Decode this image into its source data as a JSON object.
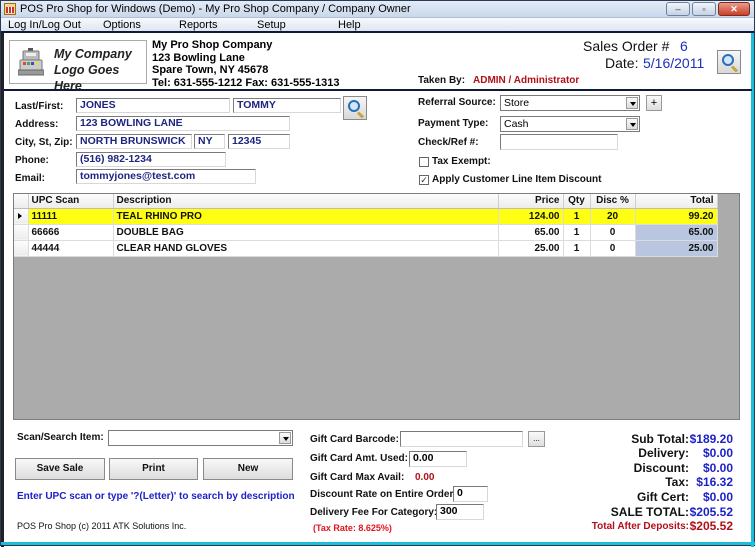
{
  "window": {
    "title": "POS Pro Shop for Windows (Demo)  - My Pro Shop Company / Company Owner",
    "minimize": "–",
    "maximize": "▫",
    "close": "✕"
  },
  "menu": [
    "Log In/Log Out",
    "Options",
    "Reports",
    "Setup",
    "Help"
  ],
  "logo": {
    "line1": "My Company",
    "line2": "Logo Goes Here"
  },
  "company": {
    "name": "My Pro Shop Company",
    "address": "123 Bowling Lane",
    "city": "Spare Town, NY 45678",
    "contact": "Tel: 631-555-1212  Fax: 631-555-1313"
  },
  "order": {
    "number_label": "Sales Order #",
    "number": "6",
    "date_label": "Date:",
    "date": "5/16/2011",
    "taken_by_label": "Taken By:",
    "taken_by": "ADMIN / Administrator"
  },
  "customer": {
    "last_first_label": "Last/First:",
    "last": "JONES",
    "first": "TOMMY",
    "address_label": "Address:",
    "address": "123 BOWLING LANE",
    "city_label": "City, St, Zip:",
    "city": "NORTH BRUNSWICK",
    "state": "NY",
    "zip": "12345",
    "phone_label": "Phone:",
    "phone": "(516) 982-1234",
    "email_label": "Email:",
    "email": "tommyjones@test.com"
  },
  "sale_options": {
    "referral_label": "Referral Source:",
    "referral": "Store",
    "add_label": "+",
    "payment_label": "Payment Type:",
    "payment": "Cash",
    "check_label": "Check/Ref #:",
    "check": "",
    "tax_exempt_label": "Tax Exempt:",
    "tax_exempt": false,
    "apply_discount_label": "Apply Customer Line Item Discount",
    "apply_discount": true
  },
  "grid": {
    "columns": [
      "UPC Scan",
      "Description",
      "Price",
      "Qty",
      "Disc %",
      "Total"
    ],
    "rows": [
      {
        "upc": "11111",
        "description": "TEAL RHINO PRO",
        "price": "124.00",
        "qty": "1",
        "disc": "20",
        "total": "99.20",
        "selected": true
      },
      {
        "upc": "66666",
        "description": "DOUBLE BAG",
        "price": "65.00",
        "qty": "1",
        "disc": "0",
        "total": "65.00",
        "selected": false
      },
      {
        "upc": "44444",
        "description": "CLEAR HAND GLOVES",
        "price": "25.00",
        "qty": "1",
        "disc": "0",
        "total": "25.00",
        "selected": false
      }
    ]
  },
  "footer": {
    "scan_label": "Scan/Search Item:",
    "scan_value": "",
    "save_label": "Save Sale",
    "print_label": "Print",
    "new_label": "New",
    "hint": "Enter UPC scan or type '?(Letter)' to search by description",
    "copyright": "POS Pro Shop (c) 2011 ATK Solutions Inc."
  },
  "giftcard": {
    "barcode_label": "Gift Card Barcode:",
    "barcode": "",
    "browse_label": "...",
    "amt_used_label": "Gift Card Amt. Used:",
    "amt_used": "0.00",
    "max_avail_label": "Gift Card Max Avail:",
    "max_avail": "0.00",
    "discount_rate_label": "Discount Rate on Entire Order:",
    "discount_rate": "0",
    "delivery_fee_label": "Delivery Fee For Category:",
    "delivery_fee": "300",
    "tax_rate": "(Tax Rate: 8.625%)"
  },
  "totals": {
    "subtotal_label": "Sub Total:",
    "subtotal": "$189.20",
    "delivery_label": "Delivery:",
    "delivery": "$0.00",
    "discount_label": "Discount:",
    "discount": "$0.00",
    "tax_label": "Tax:",
    "tax": "$16.32",
    "giftcert_label": "Gift Cert:",
    "giftcert": "$0.00",
    "sale_total_label": "SALE TOTAL:",
    "sale_total": "$205.52",
    "after_deposits_label": "Total After Deposits:",
    "after_deposits": "$205.52"
  }
}
